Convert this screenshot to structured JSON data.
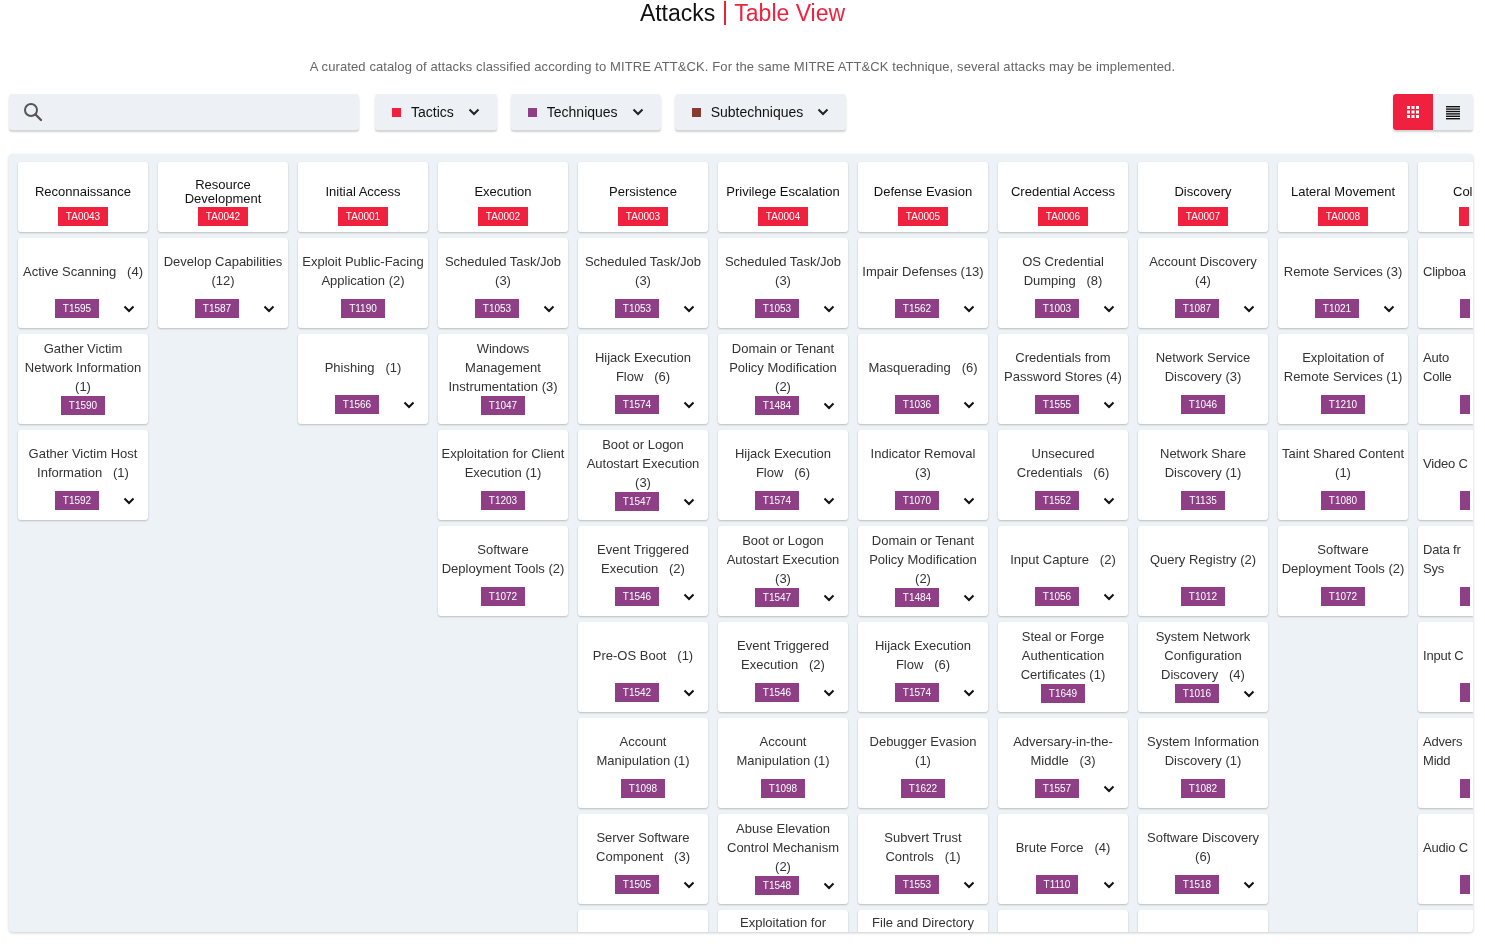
{
  "page": {
    "title": "Attacks",
    "subtitle": "Table View",
    "description": "A curated catalog of attacks classified according to MITRE ATT&CK. For the same MITRE ATT&CK technique, several attacks may be implemented."
  },
  "filters": [
    {
      "label": "Tactics",
      "color": "#f0213f"
    },
    {
      "label": "Techniques",
      "color": "#8e3f86"
    },
    {
      "label": "Subtechniques",
      "color": "#8a3b2f"
    }
  ],
  "views": [
    {
      "kind": "grid",
      "selected": true
    },
    {
      "kind": "list",
      "selected": false
    }
  ],
  "columns": [
    {
      "tactic": "Reconnaissance",
      "id": "TA0043",
      "techniques": [
        {
          "name": "Active Scanning   (4)",
          "id": "T1595",
          "expandable": true
        },
        {
          "name": "Gather Victim Network Information (1)",
          "id": "T1590",
          "expandable": false
        },
        {
          "name": "Gather Victim Host Information   (1)",
          "id": "T1592",
          "expandable": true
        }
      ]
    },
    {
      "tactic": "Resource Development",
      "id": "TA0042",
      "techniques": [
        {
          "name": "Develop Capabilities (12)",
          "id": "T1587",
          "expandable": true
        }
      ]
    },
    {
      "tactic": "Initial Access",
      "id": "TA0001",
      "techniques": [
        {
          "name": "Exploit Public-Facing Application (2)",
          "id": "T1190",
          "expandable": false
        },
        {
          "name": "Phishing   (1)",
          "id": "T1566",
          "expandable": true
        }
      ]
    },
    {
      "tactic": "Execution",
      "id": "TA0002",
      "techniques": [
        {
          "name": "Scheduled Task/Job (3)",
          "id": "T1053",
          "expandable": true
        },
        {
          "name": "Windows Management Instrumentation (3)",
          "id": "T1047",
          "expandable": false
        },
        {
          "name": "Exploitation for Client Execution (1)",
          "id": "T1203",
          "expandable": false
        },
        {
          "name": "Software Deployment Tools (2)",
          "id": "T1072",
          "expandable": false
        }
      ]
    },
    {
      "tactic": "Persistence",
      "id": "TA0003",
      "techniques": [
        {
          "name": "Scheduled Task/Job (3)",
          "id": "T1053",
          "expandable": true
        },
        {
          "name": "Hijack Execution Flow   (6)",
          "id": "T1574",
          "expandable": true
        },
        {
          "name": "Boot or Logon Autostart Execution (3)",
          "id": "T1547",
          "expandable": true
        },
        {
          "name": "Event Triggered Execution   (2)",
          "id": "T1546",
          "expandable": true
        },
        {
          "name": "Pre-OS Boot   (1)",
          "id": "T1542",
          "expandable": true
        },
        {
          "name": "Account Manipulation (1)",
          "id": "T1098",
          "expandable": false
        },
        {
          "name": "Server Software Component   (3)",
          "id": "T1505",
          "expandable": true
        },
        {
          "kind": "cut"
        }
      ]
    },
    {
      "tactic": "Privilege Escalation",
      "id": "TA0004",
      "techniques": [
        {
          "name": "Scheduled Task/Job (3)",
          "id": "T1053",
          "expandable": true
        },
        {
          "name": "Domain or Tenant Policy Modification (2)",
          "id": "T1484",
          "expandable": true
        },
        {
          "name": "Hijack Execution Flow   (6)",
          "id": "T1574",
          "expandable": true
        },
        {
          "name": "Boot or Logon Autostart Execution (3)",
          "id": "T1547",
          "expandable": true
        },
        {
          "name": "Event Triggered Execution   (2)",
          "id": "T1546",
          "expandable": true
        },
        {
          "name": "Account Manipulation (1)",
          "id": "T1098",
          "expandable": false
        },
        {
          "name": "Abuse Elevation Control Mechanism (2)",
          "id": "T1548",
          "expandable": true
        },
        {
          "name": "Exploitation for",
          "kind": "cut"
        }
      ]
    },
    {
      "tactic": "Defense Evasion",
      "id": "TA0005",
      "techniques": [
        {
          "name": "Impair Defenses (13)",
          "id": "T1562",
          "expandable": true
        },
        {
          "name": "Masquerading   (6)",
          "id": "T1036",
          "expandable": true
        },
        {
          "name": "Indicator Removal (3)",
          "id": "T1070",
          "expandable": true
        },
        {
          "name": "Domain or Tenant Policy Modification (2)",
          "id": "T1484",
          "expandable": true
        },
        {
          "name": "Hijack Execution Flow   (6)",
          "id": "T1574",
          "expandable": true
        },
        {
          "name": "Debugger Evasion (1)",
          "id": "T1622",
          "expandable": false
        },
        {
          "name": "Subvert Trust Controls   (1)",
          "id": "T1553",
          "expandable": true
        },
        {
          "name": "File and Directory",
          "kind": "cut"
        }
      ]
    },
    {
      "tactic": "Credential Access",
      "id": "TA0006",
      "techniques": [
        {
          "name": "OS Credential Dumping   (8)",
          "id": "T1003",
          "expandable": true
        },
        {
          "name": "Credentials from Password Stores (4)",
          "id": "T1555",
          "expandable": true
        },
        {
          "name": "Unsecured Credentials   (6)",
          "id": "T1552",
          "expandable": true
        },
        {
          "name": "Input Capture   (2)",
          "id": "T1056",
          "expandable": true
        },
        {
          "name": "Steal or Forge Authentication Certificates (1)",
          "id": "T1649",
          "expandable": false
        },
        {
          "name": "Adversary-in-the-Middle   (3)",
          "id": "T1557",
          "expandable": true
        },
        {
          "name": "Brute Force   (4)",
          "id": "T1110",
          "expandable": true
        },
        {
          "kind": "cut"
        }
      ]
    },
    {
      "tactic": "Discovery",
      "id": "TA0007",
      "techniques": [
        {
          "name": "Account Discovery (4)",
          "id": "T1087",
          "expandable": true
        },
        {
          "name": "Network Service Discovery (3)",
          "id": "T1046",
          "expandable": false
        },
        {
          "name": "Network Share Discovery (1)",
          "id": "T1135",
          "expandable": false
        },
        {
          "name": "Query Registry (2)",
          "id": "T1012",
          "expandable": false
        },
        {
          "name": "System Network Configuration Discovery   (4)",
          "id": "T1016",
          "expandable": true
        },
        {
          "name": "System Information Discovery (1)",
          "id": "T1082",
          "expandable": false
        },
        {
          "name": "Software Discovery (6)",
          "id": "T1518",
          "expandable": true
        },
        {
          "kind": "cut"
        }
      ]
    },
    {
      "tactic": "Lateral Movement",
      "id": "TA0008",
      "techniques": [
        {
          "name": "Remote Services (3)",
          "id": "T1021",
          "expandable": true
        },
        {
          "name": "Exploitation of Remote Services (1)",
          "id": "T1210",
          "expandable": false
        },
        {
          "name": "Taint Shared Content (1)",
          "id": "T1080",
          "expandable": false
        },
        {
          "name": "Software Deployment Tools (2)",
          "id": "T1072",
          "expandable": false
        }
      ]
    },
    {
      "tactic": "Col",
      "clipped": true,
      "techniques": [
        {
          "name": "Clipboa",
          "expandable": false
        },
        {
          "name": "Auto Colle",
          "expandable": false
        },
        {
          "name": "Video C",
          "expandable": false
        },
        {
          "name": "Data fr Sys",
          "expandable": false
        },
        {
          "name": "Input C",
          "expandable": false
        },
        {
          "name": "Advers Midd",
          "expandable": false
        },
        {
          "name": "Audio C",
          "expandable": false
        },
        {
          "kind": "cut"
        }
      ]
    }
  ]
}
